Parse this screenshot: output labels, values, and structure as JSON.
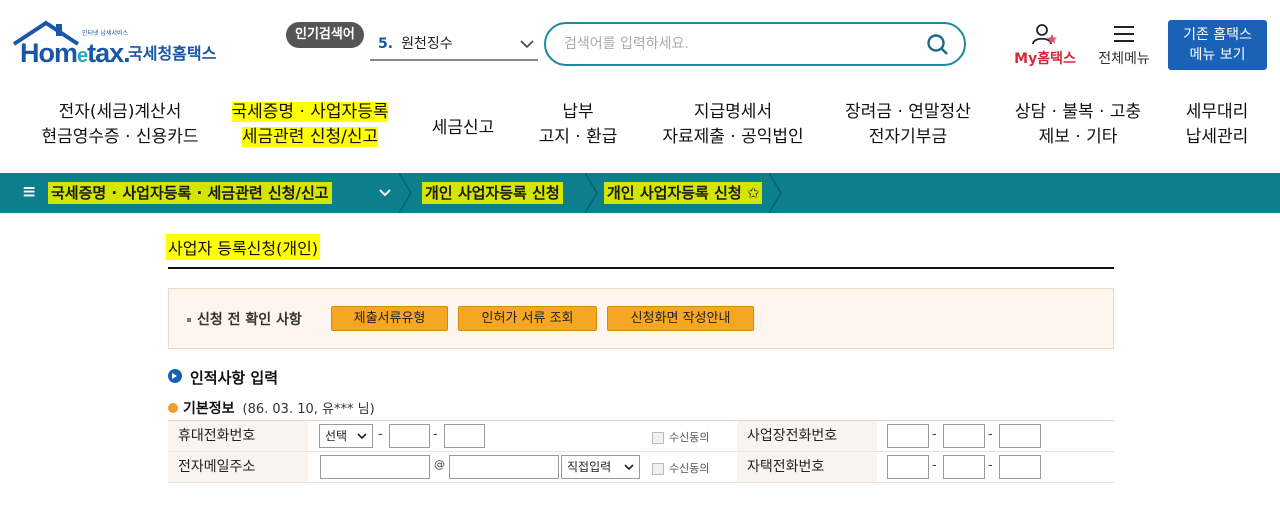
{
  "header": {
    "logo": {
      "tagline": "인터넷 납세서비스",
      "wordmark_pre": "Hom",
      "wordmark_e": "e",
      "wordmark_post": "tax.",
      "korean": "국세청홈택스"
    },
    "popular": {
      "badge": "인기검색어",
      "rank": "5.",
      "term": "원천징수"
    },
    "search": {
      "placeholder": "검색어를 입력하세요."
    },
    "my_hometax": "My홈택스",
    "all_menu": "전체메뉴",
    "old_menu_line1": "기존 홈택스",
    "old_menu_line2": "메뉴 보기"
  },
  "nav": [
    {
      "line1": "전자(세금)계산서",
      "line2": "현금영수증 · 신용카드"
    },
    {
      "line1": "국세증명 · 사업자등록",
      "line2": "세금관련 신청/신고"
    },
    {
      "line1": "세금신고",
      "line2": ""
    },
    {
      "line1": "납부",
      "line2": "고지 · 환급"
    },
    {
      "line1": "지급명세서",
      "line2": "자료제출 · 공익법인"
    },
    {
      "line1": "장려금 · 연말정산",
      "line2": "전자기부금"
    },
    {
      "line1": "상담 · 불복 · 고충",
      "line2": "제보 · 기타"
    },
    {
      "line1": "세무대리",
      "line2": "납세관리"
    }
  ],
  "breadcrumb": {
    "menu_icon": "≡",
    "items": [
      "국세증명 · 사업자등록 · 세금관련 신청/신고",
      "개인 사업자등록 신청",
      "개인 사업자등록 신청"
    ],
    "star": "✩"
  },
  "page": {
    "title": "사업자 등록신청(개인)",
    "precheck": {
      "label": "신청 전 확인 사항",
      "buttons": [
        "제출서류유형",
        "인허가 서류 조회",
        "신청화면 작성안내"
      ]
    },
    "section_title": "인적사항 입력",
    "basic_info": {
      "label": "기본정보",
      "detail": "(86. 03. 10, 유*** 님)"
    },
    "form": {
      "mobile_label": "휴대전화번호",
      "mobile_select": "선택",
      "email_label": "전자메일주소",
      "email_at": "@",
      "email_domain_select": "직접입력",
      "consent_label": "수신동의",
      "business_phone_label": "사업장전화번호",
      "home_phone_label": "자택전화번호",
      "dash": "-"
    }
  }
}
